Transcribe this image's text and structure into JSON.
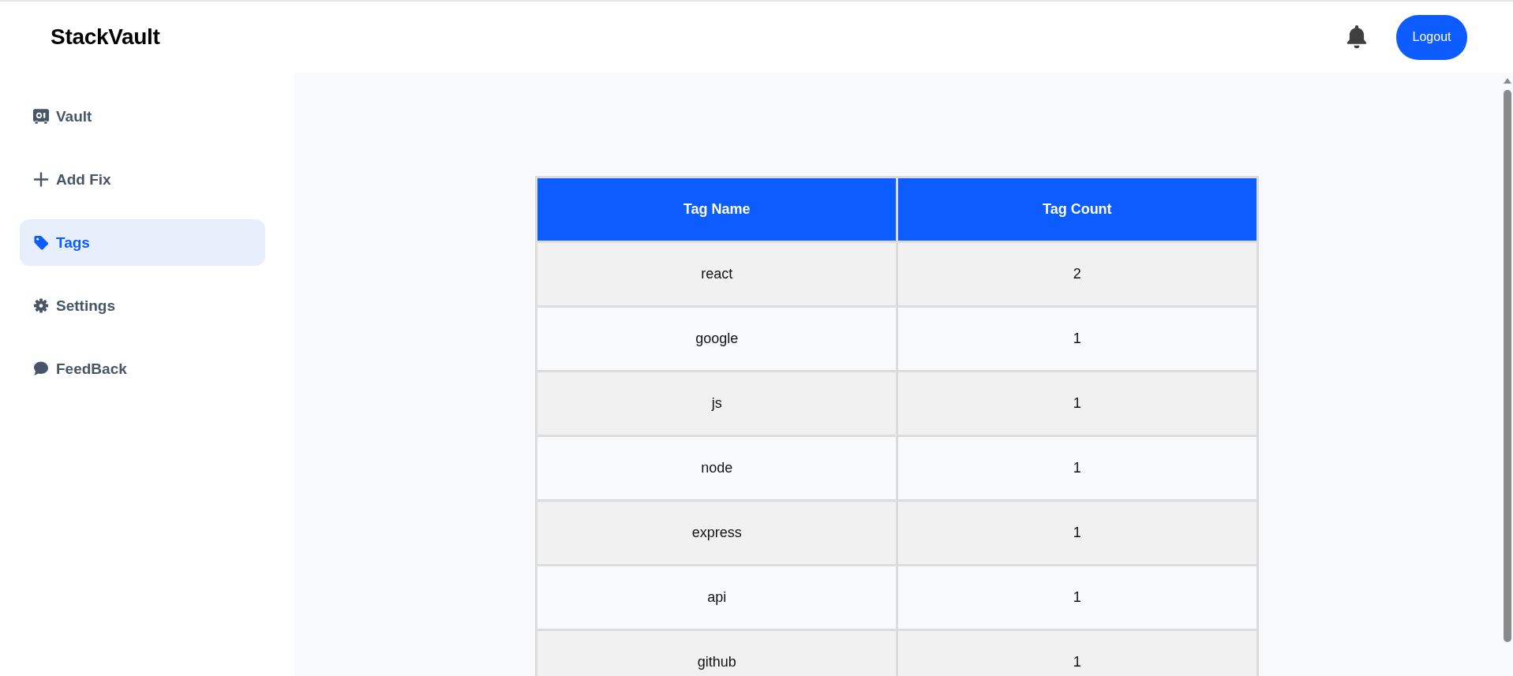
{
  "header": {
    "logo": "StackVault",
    "logout_button": "Logout"
  },
  "sidebar": {
    "items": [
      {
        "label": "Vault",
        "selected": false
      },
      {
        "label": "Add Fix",
        "selected": false
      },
      {
        "label": "Tags",
        "selected": true
      },
      {
        "label": "Settings",
        "selected": false
      },
      {
        "label": "FeedBack",
        "selected": false
      }
    ]
  },
  "table": {
    "columns": [
      "Tag Name",
      "Tag Count"
    ],
    "rows": [
      [
        "react",
        "2"
      ],
      [
        "google",
        "1"
      ],
      [
        "js",
        "1"
      ],
      [
        "node",
        "1"
      ],
      [
        "express",
        "1"
      ],
      [
        "api",
        "1"
      ],
      [
        "github",
        "1"
      ]
    ]
  }
}
